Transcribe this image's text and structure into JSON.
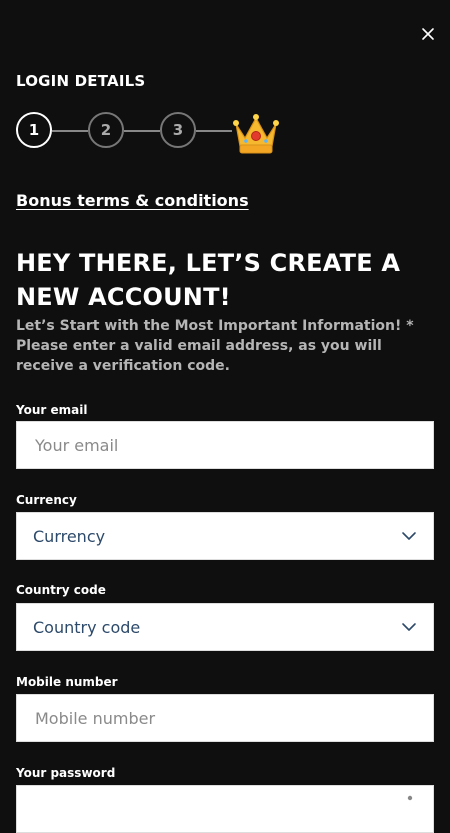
{
  "header": {
    "close_icon": "close-icon"
  },
  "section": {
    "title": "LOGIN DETAILS"
  },
  "steps": [
    "1",
    "2",
    "3"
  ],
  "crown_icon": "crown-icon",
  "bonus_link": "Bonus terms & conditions",
  "headline": "HEY THERE, LET’S CREATE A NEW ACCOUNT!",
  "intro": "Let’s Start with the Most Important Information! * Please enter a valid email address, as you will receive a verification code.",
  "form": {
    "email": {
      "label": "Your email",
      "placeholder": "Your email"
    },
    "currency": {
      "label": "Currency",
      "value": "Currency"
    },
    "country_code": {
      "label": "Country code",
      "value": "Country code"
    },
    "mobile": {
      "label": "Mobile number",
      "placeholder": "Mobile number"
    },
    "password": {
      "label": "Your password"
    }
  },
  "colors": {
    "background": "#0f0f0f",
    "select_text": "#2d4a6a",
    "inactive_step": "#777777"
  }
}
